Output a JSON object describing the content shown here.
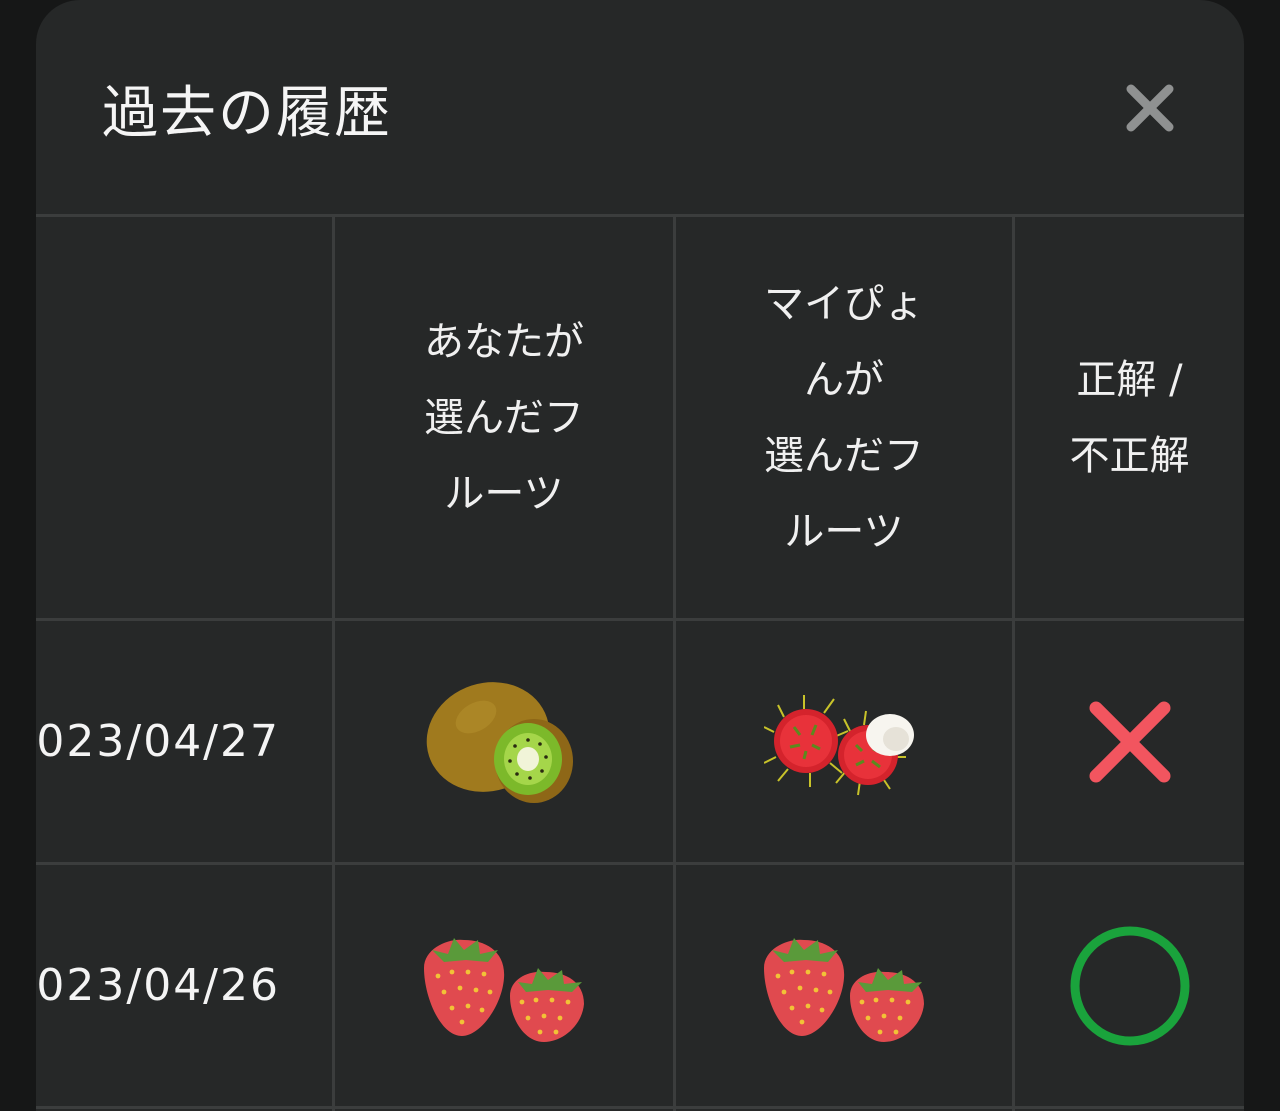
{
  "modal": {
    "title": "過去の履歴",
    "close_icon": "close-icon"
  },
  "table": {
    "headers": [
      "",
      "あなたが\n選んだフ\nルーツ",
      "マイぴょ\nんが\n選んだフ\nルーツ",
      "正解 /\n不正解"
    ],
    "rows": [
      {
        "date": "023/04/27",
        "your_fruit": "kiwi",
        "maipyon_fruit": "rambutan",
        "result": "incorrect"
      },
      {
        "date": "023/04/26",
        "your_fruit": "strawberry",
        "maipyon_fruit": "strawberry",
        "result": "correct"
      }
    ]
  },
  "colors": {
    "background": "#262828",
    "grid": "#3b3d3d",
    "incorrect": "#f2555f",
    "correct": "#1aa33c"
  }
}
